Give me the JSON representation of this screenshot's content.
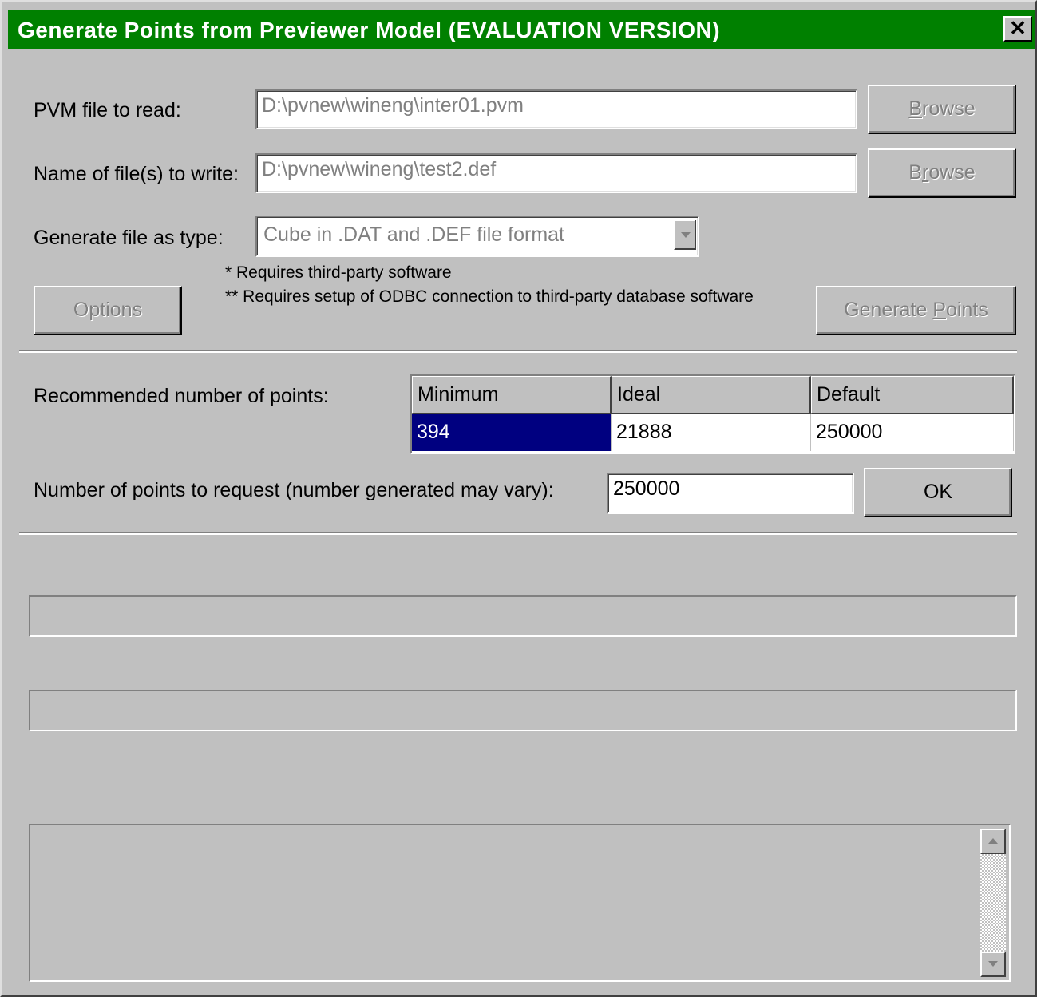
{
  "window": {
    "title": "Generate Points from Previewer Model (EVALUATION VERSION)",
    "close_glyph": "✕"
  },
  "pvm": {
    "label": "PVM file to read:",
    "value": "D:\\pvnew\\wineng\\inter01.pvm",
    "browse_label": "Browse",
    "browse_accel": "B",
    "browse_rest": "rowse"
  },
  "output": {
    "label": "Name of file(s) to write:",
    "value": "D:\\pvnew\\wineng\\test2.def",
    "browse_pre": "B",
    "browse_accel": "r",
    "browse_rest": "owse"
  },
  "filetype": {
    "label": "Generate file as type:",
    "selected": "Cube in .DAT and .DEF file format"
  },
  "notes": {
    "note1": "* Requires third-party software",
    "note2": "** Requires setup of ODBC connection to third-party database software"
  },
  "buttons": {
    "options": "Options",
    "generate_pre": "Generate ",
    "generate_accel": "P",
    "generate_rest": "oints",
    "ok": "OK"
  },
  "recommended": {
    "label": "Recommended number of points:",
    "headers": [
      "Minimum",
      "Ideal",
      "Default"
    ],
    "values": [
      "394",
      "21888",
      "250000"
    ]
  },
  "request": {
    "label": "Number of points to request (number generated may vary):",
    "value": "250000"
  },
  "colors": {
    "titlebar": "#008000",
    "dialog_bg": "#c0c0c0",
    "selection": "#000080"
  },
  "icons": {
    "close": "close-icon",
    "dropdown": "chevron-down-icon",
    "scroll_up": "scroll-up-arrow-icon",
    "scroll_down": "scroll-down-arrow-icon"
  }
}
